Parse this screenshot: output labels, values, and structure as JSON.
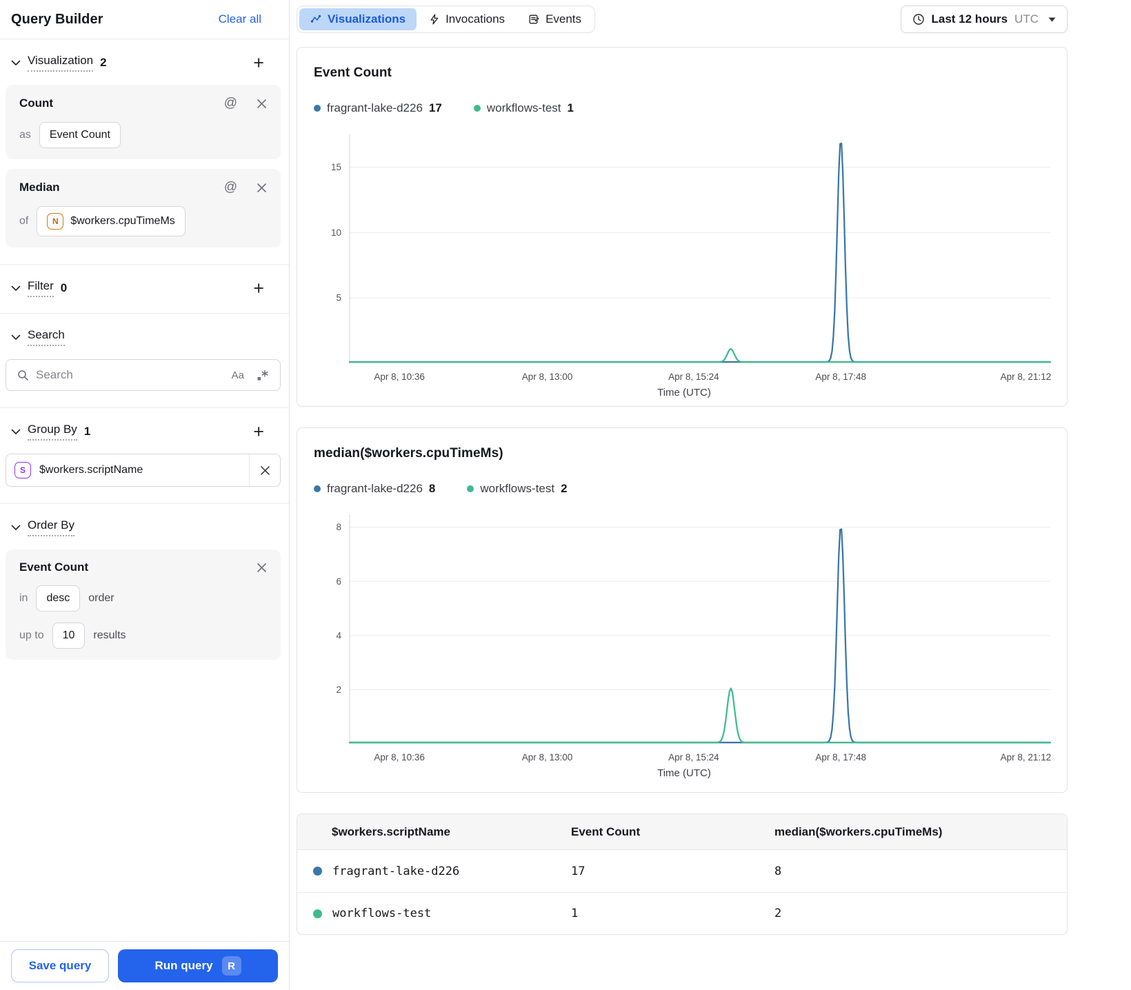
{
  "sidebar": {
    "title": "Query Builder",
    "clear_all": "Clear all",
    "visualization": {
      "label": "Visualization",
      "count": "2"
    },
    "viz_cards": [
      {
        "title": "Count",
        "as_label": "as",
        "value": "Event Count"
      },
      {
        "title": "Median",
        "of_label": "of",
        "badge": "N",
        "value": "$workers.cpuTimeMs"
      }
    ],
    "filter": {
      "label": "Filter",
      "count": "0"
    },
    "search": {
      "label": "Search",
      "placeholder": "Search",
      "case_icon": "Aa"
    },
    "group_by": {
      "label": "Group By",
      "count": "1",
      "badge": "S",
      "value": "$workers.scriptName"
    },
    "order_by": {
      "label": "Order By",
      "field": "Event Count",
      "in_label": "in",
      "direction": "desc",
      "order_label": "order",
      "upto_label": "up to",
      "limit": "10",
      "results_label": "results"
    },
    "footer": {
      "save": "Save query",
      "run": "Run query",
      "shortcut": "R"
    }
  },
  "toolbar": {
    "tabs": [
      {
        "label": "Visualizations",
        "active": true
      },
      {
        "label": "Invocations",
        "active": false
      },
      {
        "label": "Events",
        "active": false
      }
    ],
    "time_range": {
      "label": "Last 12 hours",
      "timezone": "UTC"
    }
  },
  "chart_data": [
    {
      "type": "line",
      "title": "Event Count",
      "xlabel": "Time (UTC)",
      "ylim": [
        0,
        17.3
      ],
      "yticks": [
        5,
        10,
        15
      ],
      "grid": true,
      "legend_position": "top",
      "x_ticks": [
        {
          "label": "Apr 8, 10:36",
          "f": 0.071
        },
        {
          "label": "Apr 8, 13:00",
          "f": 0.282
        },
        {
          "label": "Apr 8, 15:24",
          "f": 0.491
        },
        {
          "label": "Apr 8, 17:48",
          "f": 0.701
        },
        {
          "label": "Apr 8, 21:12",
          "f": 0.965
        }
      ],
      "series": [
        {
          "name": "fragrant-lake-d226",
          "legend_value": "17",
          "color": "#3a76a8",
          "baseline": 0,
          "spikes": [
            {
              "f": 0.701,
              "sigma": 0.0072,
              "peak": 17
            }
          ]
        },
        {
          "name": "workflows-test",
          "legend_value": "1",
          "color": "#3dbb8d",
          "baseline": 0,
          "spikes": [
            {
              "f": 0.544,
              "sigma": 0.007,
              "peak": 1
            }
          ]
        }
      ]
    },
    {
      "type": "line",
      "title": "median($workers.cpuTimeMs)",
      "xlabel": "Time (UTC)",
      "ylim": [
        0,
        8.35
      ],
      "yticks": [
        2,
        4,
        6,
        8
      ],
      "grid": true,
      "legend_position": "top",
      "x_ticks": [
        {
          "label": "Apr 8, 10:36",
          "f": 0.071
        },
        {
          "label": "Apr 8, 13:00",
          "f": 0.282
        },
        {
          "label": "Apr 8, 15:24",
          "f": 0.491
        },
        {
          "label": "Apr 8, 17:48",
          "f": 0.701
        },
        {
          "label": "Apr 8, 21:12",
          "f": 0.965
        }
      ],
      "series": [
        {
          "name": "fragrant-lake-d226",
          "legend_value": "8",
          "color": "#3a76a8",
          "baseline": 0,
          "spikes": [
            {
              "f": 0.701,
              "sigma": 0.0075,
              "peak": 8
            }
          ]
        },
        {
          "name": "workflows-test",
          "legend_value": "2",
          "color": "#3dbb8d",
          "baseline": 0,
          "spikes": [
            {
              "f": 0.544,
              "sigma": 0.0077,
              "peak": 2
            }
          ]
        }
      ]
    },
    {
      "type": "table",
      "columns": [
        "$workers.scriptName",
        "Event Count",
        "median($workers.cpuTimeMs)"
      ],
      "rows": [
        {
          "color": "#3a76a8",
          "cells": [
            "fragrant-lake-d226",
            "17",
            "8"
          ]
        },
        {
          "color": "#3dbb8d",
          "cells": [
            "workflows-test",
            "1",
            "2"
          ]
        }
      ]
    }
  ],
  "colors": {
    "accent_blue": "#2463eb",
    "active_tab_bg": "#bcd7f8",
    "series_blue": "#3a76a8",
    "series_green": "#3dbb8d"
  }
}
